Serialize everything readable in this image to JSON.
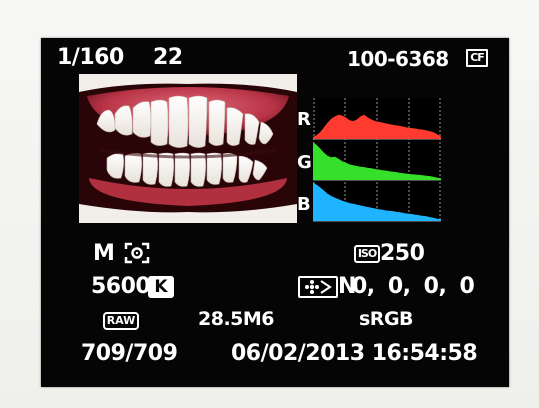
{
  "exposure": {
    "shutter_speed": "1/160",
    "aperture": "22"
  },
  "file": {
    "folder_file_number": "100-6368",
    "card_icon": "CF"
  },
  "histogram": {
    "labels": {
      "r": "R",
      "g": "G",
      "b": "B"
    },
    "colors": {
      "r": "#ff3b2f",
      "g": "#36e02a",
      "b": "#1fb4ff"
    },
    "levels": {
      "r": [
        0.05,
        0.1,
        0.18,
        0.3,
        0.42,
        0.52,
        0.58,
        0.62,
        0.6,
        0.55,
        0.48,
        0.46,
        0.5,
        0.58,
        0.62,
        0.55,
        0.5,
        0.46,
        0.44,
        0.42,
        0.4,
        0.38,
        0.36,
        0.35,
        0.33,
        0.31,
        0.29,
        0.28,
        0.27,
        0.25,
        0.24,
        0.22,
        0.2,
        0.17,
        0.12,
        0.06
      ],
      "g": [
        0.96,
        0.9,
        0.8,
        0.7,
        0.62,
        0.58,
        0.6,
        0.54,
        0.48,
        0.44,
        0.4,
        0.38,
        0.36,
        0.34,
        0.33,
        0.31,
        0.3,
        0.28,
        0.27,
        0.25,
        0.24,
        0.22,
        0.21,
        0.2,
        0.18,
        0.17,
        0.16,
        0.15,
        0.14,
        0.13,
        0.12,
        0.11,
        0.1,
        0.08,
        0.06,
        0.04
      ],
      "b": [
        0.98,
        0.93,
        0.86,
        0.78,
        0.7,
        0.64,
        0.6,
        0.56,
        0.52,
        0.49,
        0.46,
        0.44,
        0.42,
        0.4,
        0.38,
        0.36,
        0.34,
        0.32,
        0.3,
        0.29,
        0.27,
        0.26,
        0.25,
        0.23,
        0.22,
        0.2,
        0.19,
        0.18,
        0.16,
        0.15,
        0.13,
        0.12,
        0.1,
        0.08,
        0.06,
        0.04
      ]
    }
  },
  "settings": {
    "shooting_mode": "M",
    "metering_icon": "evaluative-metering-icon",
    "iso_label": "ISO",
    "iso_value": "250",
    "white_balance_value": "5600",
    "white_balance_unit": "K",
    "picture_style_letter": "N",
    "picture_style_params": "0, 0, 0, 0",
    "quality": "RAW",
    "megapixels": "28.5M6",
    "color_space": "sRGB"
  },
  "playback": {
    "image_count": "709/709",
    "date_time": "06/02/2013 16:54:58"
  }
}
